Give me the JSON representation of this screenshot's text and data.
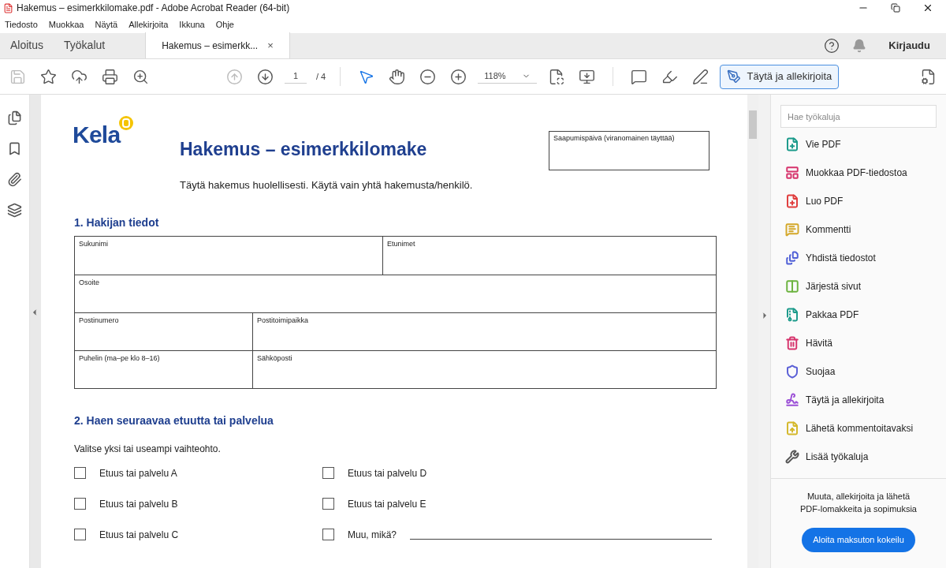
{
  "window": {
    "title": "Hakemus – esimerkkilomake.pdf - Adobe Acrobat Reader (64-bit)"
  },
  "menu": [
    "Tiedosto",
    "Muokkaa",
    "Näytä",
    "Allekirjoita",
    "Ikkuna",
    "Ohje"
  ],
  "tabs": [
    {
      "label": "Aloitus",
      "selected": false,
      "kind": "nav"
    },
    {
      "label": "Työkalut",
      "selected": false,
      "kind": "nav"
    },
    {
      "label": "Hakemus – esimerkk...",
      "selected": true,
      "kind": "doc",
      "close": "×"
    }
  ],
  "sign_in": "Kirjaudu",
  "toolbar": {
    "page": "1",
    "page_total": "/ 4",
    "zoom": "118%",
    "fill_sign": "Täytä ja allekirjoita"
  },
  "document": {
    "logo": "Kela",
    "title": "Hakemus – esimerkkilomake",
    "intro": "Täytä hakemus huolellisesti. Käytä vain yhtä hakemusta/henkilö.",
    "arrival_box": "Saapumispäivä (viranomainen täyttää)",
    "section_1": "1. Hakijan tiedot",
    "form_rows": [
      [
        "Sukunimi",
        "Etunimet"
      ],
      [
        "Osoite"
      ],
      [
        "Postinumero",
        "Postitoimipaikka"
      ],
      [
        "Puhelin (ma–pe klo 8–16)",
        "Sähköposti"
      ]
    ],
    "section_2": "2. Haen seuraavaa etuutta tai palvelua",
    "instruction": "Valitse yksi tai useampi vaihteohto.",
    "options": [
      {
        "label": "Etuus tai palvelu A",
        "checked": false,
        "kind": "plain"
      },
      {
        "label": "Etuus tai palvelu B",
        "checked": false,
        "kind": "plain"
      },
      {
        "label": "Etuus tai palvelu C",
        "checked": false,
        "kind": "plain"
      },
      {
        "label": "Etuus tai palvelu D",
        "checked": false,
        "kind": "plain"
      },
      {
        "label": "Etuus tai palvelu E",
        "checked": false,
        "kind": "plain"
      },
      {
        "label": "Muu, mikä?",
        "checked": false,
        "kind": "other"
      }
    ]
  },
  "tools_panel": {
    "search": {
      "placeholder": "Hae työkaluja"
    },
    "tools": [
      {
        "label": "Vie PDF",
        "color": "#1a9a8a",
        "kind": "export"
      },
      {
        "label": "Muokkaa PDF-tiedostoa",
        "color": "#d6336c",
        "kind": "edit"
      },
      {
        "label": "Luo PDF",
        "color": "#e03c3c",
        "kind": "create"
      },
      {
        "label": "Kommentti",
        "color": "#d4a82a",
        "kind": "comment"
      },
      {
        "label": "Yhdistä tiedostot",
        "color": "#4f5fd6",
        "kind": "combine"
      },
      {
        "label": "Järjestä sivut",
        "color": "#6cb33f",
        "kind": "organize"
      },
      {
        "label": "Pakkaa PDF",
        "color": "#1a9a8a",
        "kind": "compress"
      },
      {
        "label": "Hävitä",
        "color": "#d6336c",
        "kind": "redact"
      },
      {
        "label": "Suojaa",
        "color": "#5a5fd6",
        "kind": "protect"
      },
      {
        "label": "Täytä ja allekirjoita",
        "color": "#9b4fd6",
        "kind": "sign"
      },
      {
        "label": "Lähetä kommentoitavaksi",
        "color": "#d4b82a",
        "kind": "send"
      },
      {
        "label": "Lisää työkaluja",
        "color": "#555555",
        "kind": "more"
      }
    ],
    "promo": "Muuta, allekirjoita ja lähetä PDF-lomakkeita ja sopimuksia",
    "trial_button": "Aloita maksuton kokeilu"
  }
}
